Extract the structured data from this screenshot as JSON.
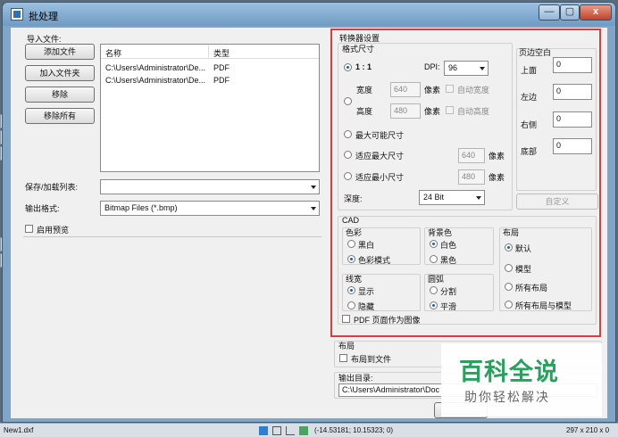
{
  "window": {
    "title": "批处理",
    "min": "—",
    "max": "▢",
    "close": "x"
  },
  "left": {
    "import_files": "导入文件:",
    "btn_add_file": "添加文件",
    "btn_add_folder": "加入文件夹",
    "btn_remove": "移除",
    "btn_remove_all": "移除所有",
    "col_name": "名称",
    "col_type": "类型",
    "rows": [
      {
        "name": "C:\\Users\\Administrator\\De...",
        "type": "PDF"
      },
      {
        "name": "C:\\Users\\Administrator\\De...",
        "type": "PDF"
      }
    ],
    "save_load_list": "保存/加载列表:",
    "save_load_value": "",
    "output_format": "输出格式:",
    "output_format_value": "Bitmap Files (*.bmp)",
    "enable_preview": "启用预览"
  },
  "converter": {
    "title": "转换器设置",
    "format_size": "格式尺寸",
    "ratio_1_1": "1 : 1",
    "dpi_label": "DPI:",
    "dpi_value": "96",
    "width_label": "宽度",
    "width_value": "640",
    "height_label": "高度",
    "height_value": "480",
    "pixels": "像素",
    "auto_width": "自动宽度",
    "auto_height": "自动高度",
    "max_possible": "最大可能尺寸",
    "fit_max": "适应最大尺寸",
    "fit_max_value": "640",
    "fit_min": "适应最小尺寸",
    "fit_min_value": "480",
    "depth_label": "深度:",
    "depth_value": "24 Bit",
    "margins_title": "页边空白",
    "top_label": "上面",
    "top_value": "0",
    "left_label": "左边",
    "left_value": "0",
    "right_label": "右侧",
    "right_value": "0",
    "bottom_label": "底部",
    "bottom_value": "0",
    "custom_button": "自定义"
  },
  "cad": {
    "title": "CAD",
    "color_title": "色彩",
    "color_bw": "黑白",
    "color_mode": "色彩模式",
    "bg_title": "背景色",
    "bg_white": "白色",
    "bg_black": "黑色",
    "layout_title": "布局",
    "layout_default": "默认",
    "layout_model": "模型",
    "layout_all": "所有布局",
    "layout_all_model": "所有布局与模型",
    "linewidth_title": "线宽",
    "lw_show": "显示",
    "lw_hide": "隐藏",
    "arc_title": "圆弧",
    "arc_split": "分割",
    "arc_smooth": "平滑",
    "pdf_as_image": "PDF 页面作为图像"
  },
  "bottom": {
    "layout_title": "布局",
    "layout_to_file": "布局到文件",
    "output_dir": "输出目录:",
    "output_dir_value": "C:\\Users\\Administrator\\Doc"
  },
  "background": {
    "sidebar_chars": [
      "屏",
      "数",
      "日",
      "收",
      "各"
    ],
    "status_file": "New1.dxf",
    "status_coords": "(-14.53181; 10.15323; 0)",
    "status_size": "297 x 210 x 0"
  },
  "watermark": {
    "line1": "百科全说",
    "line2": "助你轻松解决"
  }
}
